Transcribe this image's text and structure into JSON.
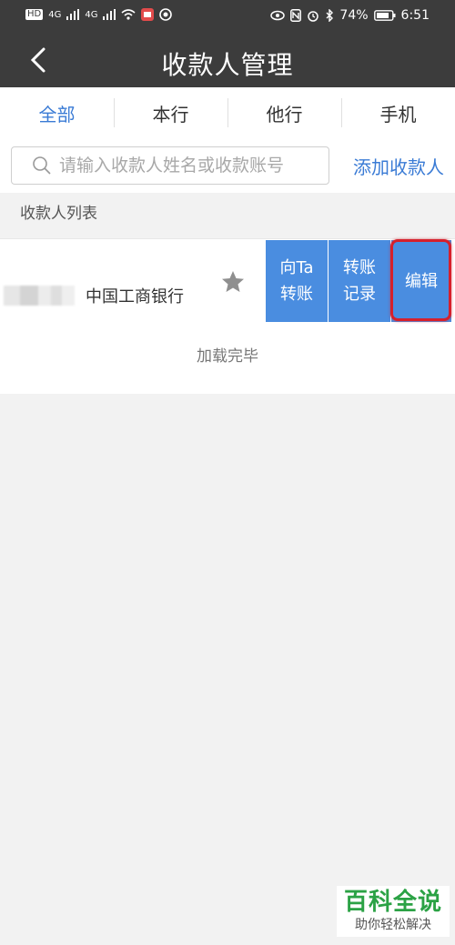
{
  "status_bar": {
    "left_indicators": [
      "HD",
      "4G",
      "4G"
    ],
    "battery": "74%",
    "time": "6:51"
  },
  "header": {
    "title": "收款人管理",
    "back_icon": "chevron-left-icon"
  },
  "tabs": [
    {
      "label": "全部",
      "active": true
    },
    {
      "label": "本行",
      "active": false
    },
    {
      "label": "他行",
      "active": false
    },
    {
      "label": "手机",
      "active": false
    }
  ],
  "search": {
    "placeholder": "请输入收款人姓名或收款账号",
    "value": "",
    "add_label": "添加收款人"
  },
  "list": {
    "section_label": "收款人列表",
    "rows": [
      {
        "bank": "中国工商银行",
        "actions": {
          "transfer_line1": "向Ta",
          "transfer_line2": "转账",
          "records_line1": "转账",
          "records_line2": "记录",
          "edit": "编辑"
        }
      }
    ],
    "footer": "加载完毕"
  },
  "watermark": {
    "main": "百科全说",
    "sub": "助你轻松解决"
  },
  "colors": {
    "header_bg": "#3c3c3c",
    "accent": "#3a7bd5",
    "action_bg": "#4a8de0",
    "highlight": "#d6202c",
    "watermark_green": "#2ba245"
  }
}
